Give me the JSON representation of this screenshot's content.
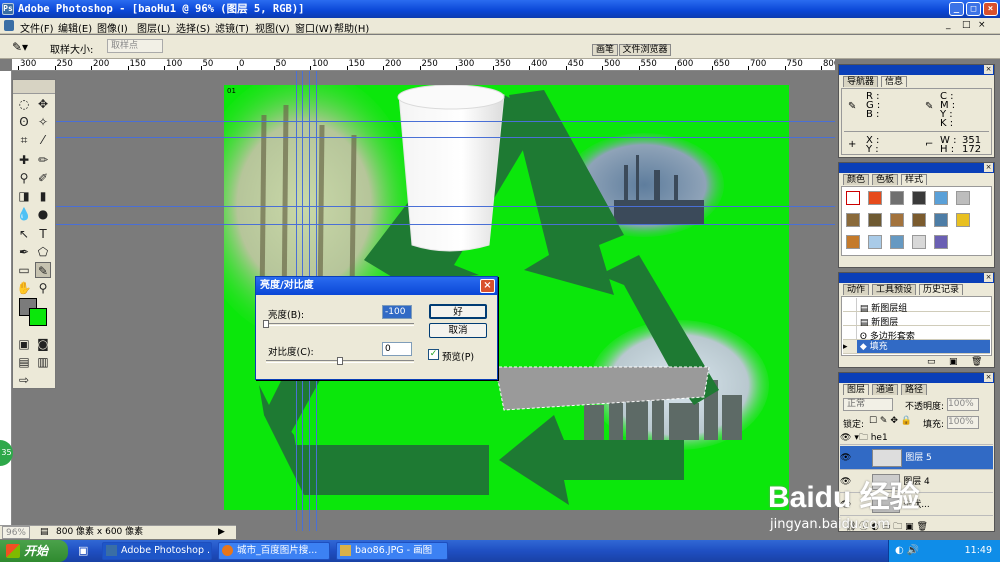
{
  "window": {
    "title": "Adobe Photoshop - [baoHu1 @ 96% (图层 5, RGB)]"
  },
  "menu": [
    "文件(F)",
    "编辑(E)",
    "图像(I)",
    "图层(L)",
    "选择(S)",
    "滤镜(T)",
    "视图(V)",
    "窗口(W)",
    "帮助(H)"
  ],
  "options": {
    "sample_label": "取样大小:",
    "sample_value": "取样点",
    "tab_brush": "画笔",
    "tab_browser": "文件浏览器"
  },
  "ruler_top": [
    "300",
    "250",
    "200",
    "150",
    "100",
    "50",
    "0",
    "50",
    "100",
    "150",
    "200",
    "250",
    "300",
    "350",
    "400",
    "450",
    "500",
    "550",
    "600",
    "650",
    "700",
    "750",
    "800"
  ],
  "canvas": {
    "doc_label": "01"
  },
  "navigator": {
    "tab_nav": "导航器",
    "tab_info": "信息",
    "r": "R :",
    "g": "G :",
    "b": "B :",
    "c": "C :",
    "m": "M :",
    "y": "Y :",
    "k": "K :",
    "x": "X :",
    "yy": "Y :",
    "w_label": "W :",
    "h_label": "H :",
    "w_val": "351",
    "h_val": "172"
  },
  "swatches": {
    "tab_color": "颜色",
    "tab_swatch": "色板",
    "tab_style": "样式"
  },
  "history": {
    "tab_actions": "动作",
    "tab_tools": "工具预设",
    "tab_history": "历史记录",
    "items": [
      "新图层组",
      "新图层",
      "多边形套索",
      "填充"
    ]
  },
  "layers": {
    "tab_layers": "图层",
    "tab_channels": "通道",
    "tab_paths": "路径",
    "blend_mode": "正常",
    "opacity_label": "不透明度:",
    "opacity_value": "100%",
    "lock_label": "锁定:",
    "fill_label": "填充:",
    "fill_value": "100%",
    "group_name": "he1",
    "layer5": "图层 5",
    "layer4": "图层 4",
    "layer_extra": "形状..."
  },
  "dialog": {
    "title": "亮度/对比度",
    "brightness_label": "亮度(B):",
    "brightness_value": "-100",
    "contrast_label": "对比度(C):",
    "contrast_value": "0",
    "ok": "好",
    "cancel": "取消",
    "preview": "预览(P)",
    "brightness_level": 0.0,
    "contrast_level": 0.5
  },
  "status": {
    "zoom": "96%",
    "doc_size": "800 像素 x 600 像素"
  },
  "taskbar": {
    "start": "开始",
    "tasks": [
      "Adobe Photoshop ...",
      "城市_百度图片搜...",
      "bao86.JPG - 画图"
    ],
    "time": "11:49"
  },
  "watermark": {
    "brand": "Baidu 经验",
    "url": "jingyan.baidu.com"
  },
  "colors": {
    "canvas_green": "#0be70b",
    "arrow_green": "#1e7a33",
    "selection_gray": "#9a9a9a",
    "xp_blue": "#0a46d6"
  }
}
